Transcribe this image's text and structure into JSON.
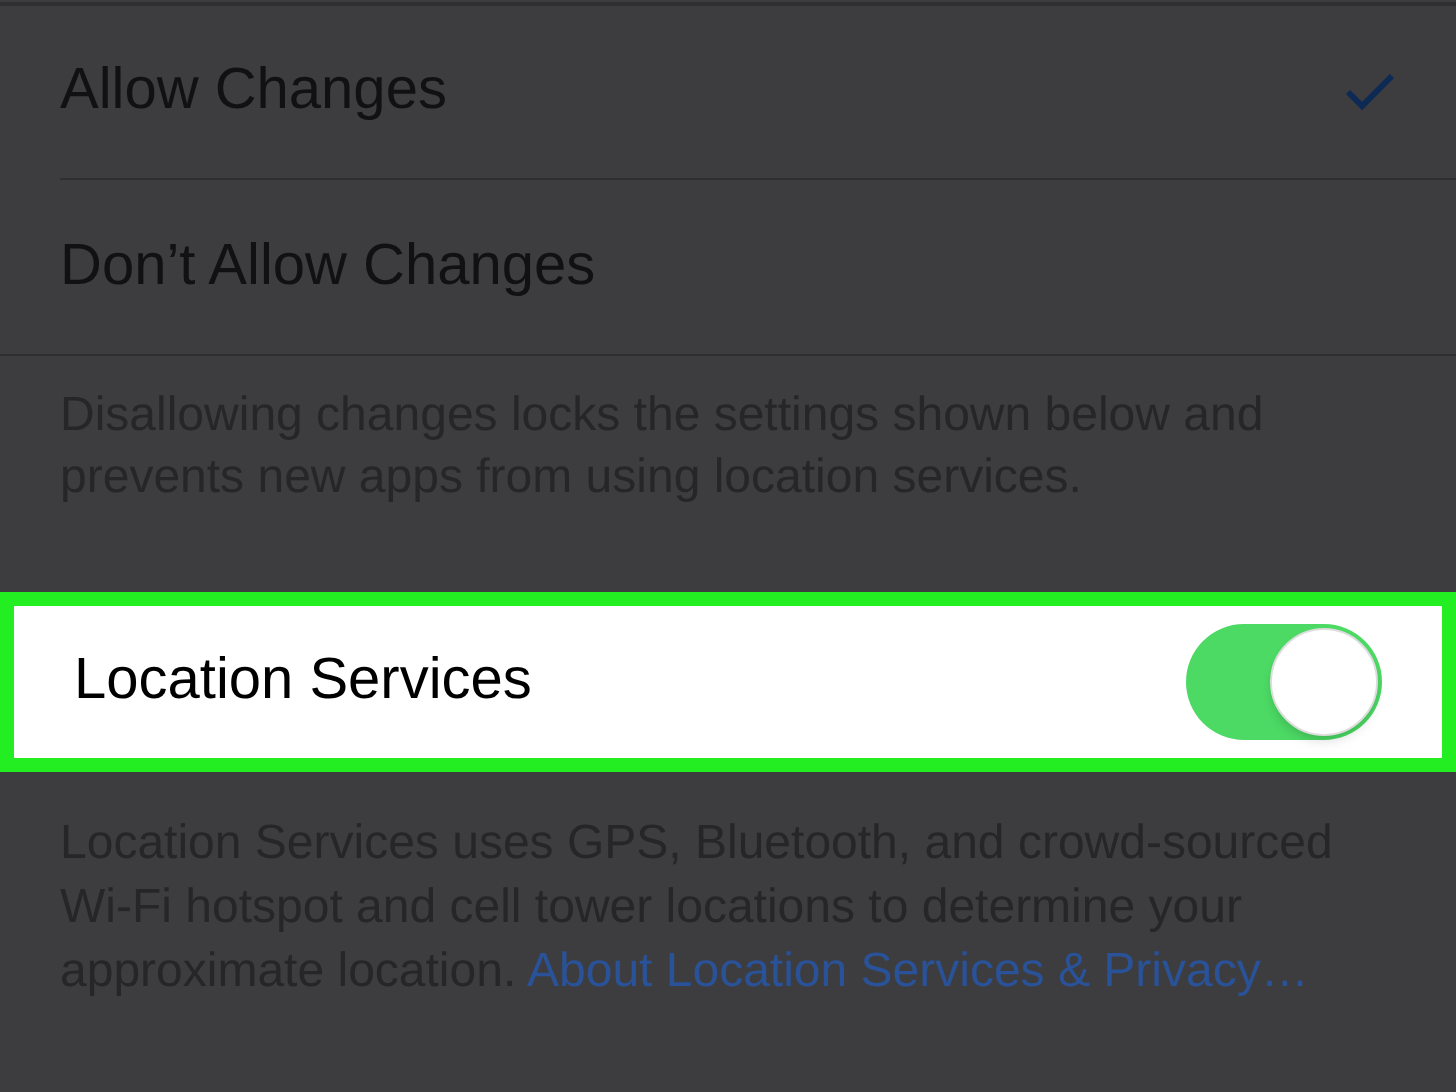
{
  "options": [
    {
      "label": "Allow Changes",
      "selected": true
    },
    {
      "label": "Don’t Allow Changes",
      "selected": false
    }
  ],
  "options_footer": "Disallowing changes locks the settings shown below and prevents new apps from using location services.",
  "location_services": {
    "label": "Location Services",
    "on": true,
    "highlighted": true
  },
  "location_footer": {
    "text": "Location Services uses GPS, Bluetooth, and crowd-sourced Wi-Fi hotspot and cell tower locations to determine your approximate location.",
    "link": "About Location Services & Privacy…"
  }
}
